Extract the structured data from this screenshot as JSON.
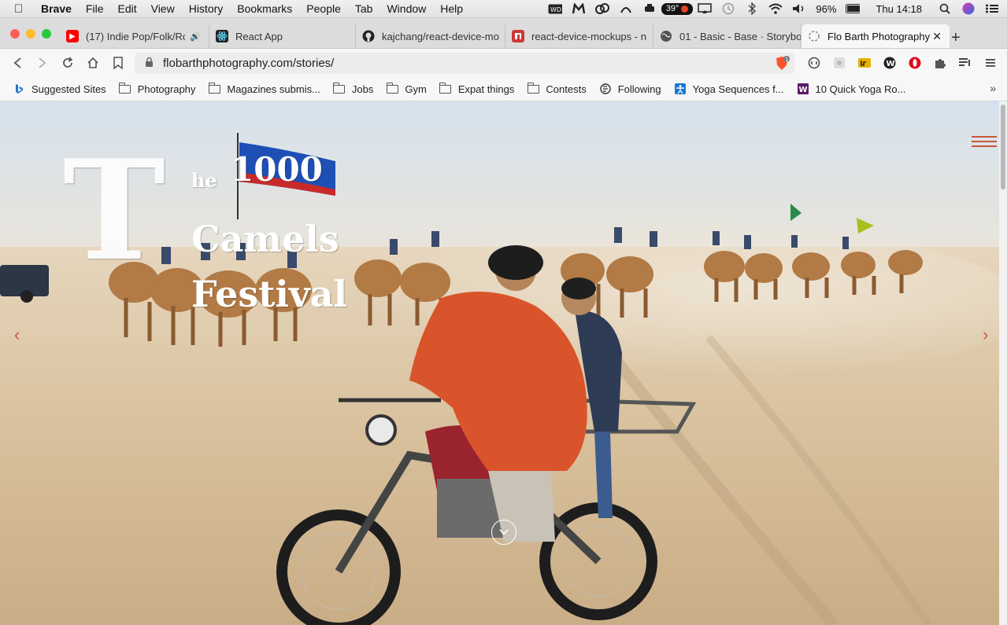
{
  "menubar": {
    "app_name": "Brave",
    "items": [
      "File",
      "Edit",
      "View",
      "History",
      "Bookmarks",
      "People",
      "Tab",
      "Window",
      "Help"
    ],
    "temperature": "39°",
    "battery": "96%",
    "clock": "Thu 14:18"
  },
  "tabs": [
    {
      "label": "(17) Indie Pop/Folk/Roc",
      "icon": "youtube-icon"
    },
    {
      "label": "React App",
      "icon": "react-icon"
    },
    {
      "label": "kajchang/react-device-mo",
      "icon": "github-icon"
    },
    {
      "label": "react-device-mockups - n",
      "icon": "npm-icon"
    },
    {
      "label": "01 - Basic - Base · Storybo",
      "icon": "globe-icon"
    },
    {
      "label": "Flo Barth Photography",
      "icon": "site-icon"
    }
  ],
  "toolbar": {
    "url": "flobarthphotography.com/stories/",
    "brave_shield_count": "1"
  },
  "bookmarks": [
    {
      "label": "Suggested Sites",
      "icon": "bing-icon"
    },
    {
      "label": "Photography",
      "icon": "folder-icon"
    },
    {
      "label": "Magazines submis...",
      "icon": "folder-icon"
    },
    {
      "label": "Jobs",
      "icon": "folder-icon"
    },
    {
      "label": "Gym",
      "icon": "folder-icon"
    },
    {
      "label": "Expat things",
      "icon": "folder-icon"
    },
    {
      "label": "Contests",
      "icon": "folder-icon"
    },
    {
      "label": "Following",
      "icon": "rss-icon"
    },
    {
      "label": "Yoga Sequences f...",
      "icon": "yoga-icon"
    },
    {
      "label": "10 Quick Yoga Ro...",
      "icon": "w-icon"
    }
  ],
  "hero": {
    "title_big_letter": "T",
    "title_he": "he",
    "title_1000": "1000",
    "title_camels": "Camels",
    "title_festival": "Festival"
  },
  "colors": {
    "accent": "#c8573a",
    "tabstrip": "#dcdcdc",
    "toolbar": "#f7f7f7"
  }
}
